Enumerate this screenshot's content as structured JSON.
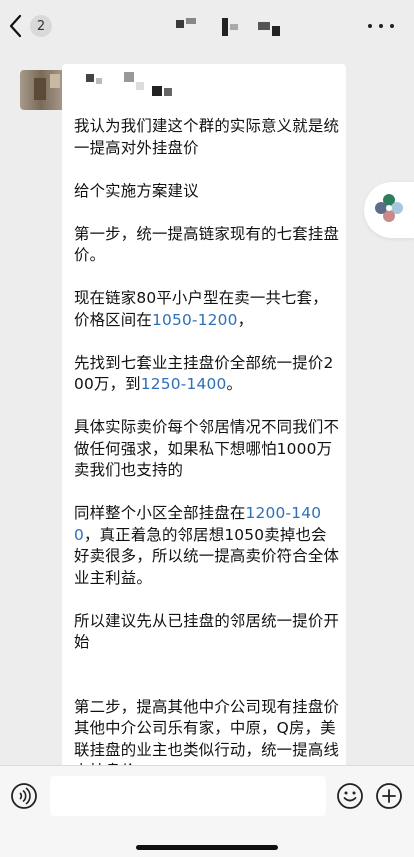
{
  "header": {
    "back_icon": "chevron-left-icon",
    "unread_count": "2",
    "title": "",
    "more_icon": "more-dots-icon"
  },
  "message": {
    "sender_name": "",
    "lines": [
      [
        {
          "t": "我认为我们建这个群的实际意义就是统一提高对外挂盘价"
        }
      ],
      [
        {
          "t": ""
        }
      ],
      [
        {
          "t": "给个实施方案建议"
        }
      ],
      [
        {
          "t": ""
        }
      ],
      [
        {
          "t": "第一步，统一提高链家现有的七套挂盘价。"
        }
      ],
      [
        {
          "t": ""
        }
      ],
      [
        {
          "t": "现在链家80平小户型在卖一共七套，价格区间在"
        },
        {
          "t": "1050-1200",
          "n": true
        },
        {
          "t": "，"
        }
      ],
      [
        {
          "t": ""
        }
      ],
      [
        {
          "t": "先找到七套业主挂盘价全部统一提价200万，到"
        },
        {
          "t": "1250-1400",
          "n": true
        },
        {
          "t": "。"
        }
      ],
      [
        {
          "t": ""
        }
      ],
      [
        {
          "t": "具体实际卖价每个邻居情况不同我们不做任何强求，如果私下想哪怕1000万卖我们也支持的"
        }
      ],
      [
        {
          "t": ""
        }
      ],
      [
        {
          "t": "同样整个小区全部挂盘在"
        },
        {
          "t": "1200-1400",
          "n": true
        },
        {
          "t": "，真正着急的邻居想1050卖掉也会好卖很多，所以统一提高卖价符合全体业主利益。"
        }
      ],
      [
        {
          "t": ""
        }
      ],
      [
        {
          "t": "所以建议先从已挂盘的邻居统一提价开始"
        }
      ],
      [
        {
          "t": ""
        }
      ],
      [
        {
          "t": ""
        }
      ],
      [
        {
          "t": "第二步，提高其他中介公司现有挂盘价"
        }
      ],
      [
        {
          "t": "其他中介公司乐有家，中原，Q房，美联挂盘的业主也类似行动，统一提高线上挂盘价"
        }
      ]
    ]
  },
  "input": {
    "placeholder": "",
    "value": "",
    "voice_icon": "voice-icon",
    "emoji_icon": "emoji-icon",
    "plus_icon": "plus-icon"
  },
  "colors": {
    "background": "#ededed",
    "bubble": "#ffffff",
    "number_highlight": "#2f6fb8"
  }
}
